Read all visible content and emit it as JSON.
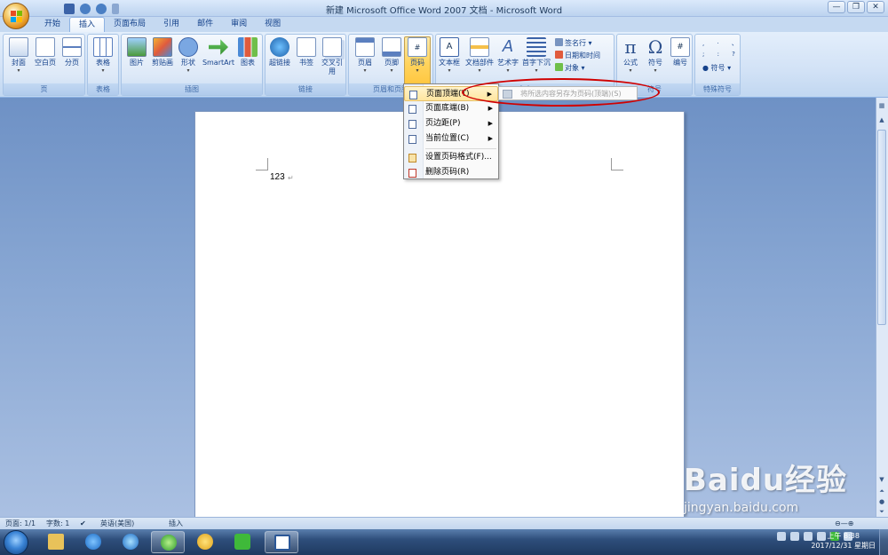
{
  "window": {
    "title": "新建 Microsoft Office Word 2007 文档 - Microsoft Word",
    "controls": [
      "—",
      "❐",
      "✕"
    ]
  },
  "tabs": [
    "开始",
    "插入",
    "页面布局",
    "引用",
    "邮件",
    "审阅",
    "视图"
  ],
  "active_tab": "插入",
  "ribbon": {
    "groups": {
      "pages": {
        "label": "页",
        "buttons": [
          "封面",
          "空白页",
          "分页"
        ]
      },
      "tables": {
        "label": "表格",
        "buttons": [
          "表格"
        ]
      },
      "illustrations": {
        "label": "插图",
        "buttons": [
          "图片",
          "剪贴画",
          "形状",
          "SmartArt",
          "图表"
        ]
      },
      "links": {
        "label": "链接",
        "buttons": [
          "超链接",
          "书签",
          "交叉引用"
        ]
      },
      "header_footer": {
        "label": "页眉和页脚",
        "buttons": [
          "页眉",
          "页脚",
          "页码"
        ]
      },
      "text": {
        "label": "文本",
        "buttons": [
          "文本框",
          "文档部件",
          "艺术字",
          "首字下沉"
        ],
        "small": [
          "签名行",
          "日期和时间",
          "对象"
        ]
      },
      "symbols": {
        "label": "符号",
        "buttons": [
          "公式",
          "符号",
          "编号"
        ]
      },
      "special": {
        "label": "特殊符号",
        "small": [
          "符号"
        ]
      }
    }
  },
  "page_number_menu": {
    "items": [
      "页面顶端(T)",
      "页面底端(B)",
      "页边距(P)",
      "当前位置(C)",
      "设置页码格式(F)...",
      "删除页码(R)"
    ],
    "highlighted": "页面顶端(T)",
    "submenu_item": "将所选内容另存为页码(顶端)(S)"
  },
  "document": {
    "text": "123"
  },
  "status": {
    "page": "页面: 1/1",
    "words": "字数: 1",
    "language": "英语(美国)",
    "mode": "插入"
  },
  "clock": {
    "time": "上午 8:38",
    "date": "2017/12/31 星期日"
  },
  "watermark": {
    "brand": "Baidu经验",
    "url": "jingyan.baidu.com"
  },
  "colors": {
    "highlight": "#ffd45e",
    "annotation": "#d00000",
    "ribbon": "#dce8f7"
  }
}
